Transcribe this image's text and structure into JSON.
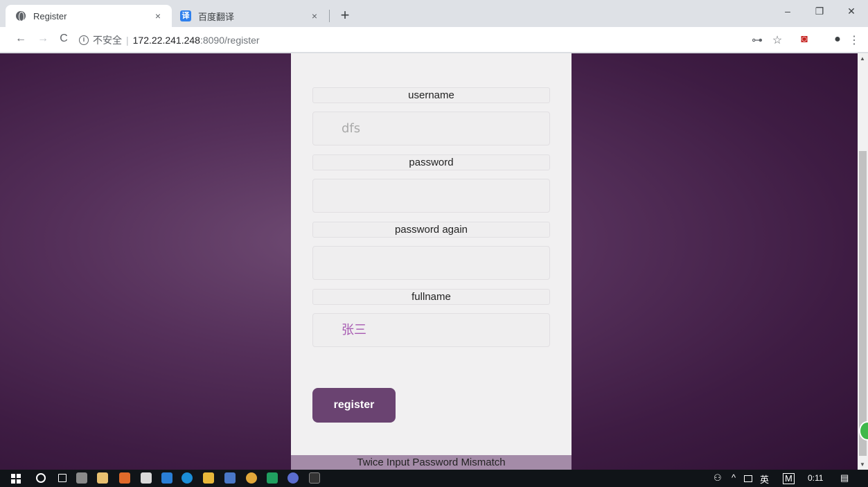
{
  "browser": {
    "tabs": [
      {
        "title": "Register",
        "favicon": "globe-icon",
        "active": true
      },
      {
        "title": "百度翻译",
        "favicon": "baidu-translate-icon",
        "favicon_text": "译",
        "active": false
      }
    ],
    "close_glyph": "×",
    "new_tab_glyph": "+",
    "window_controls": {
      "minimize": "–",
      "restore": "❐",
      "close": "✕"
    },
    "nav": {
      "back": "←",
      "forward": "→",
      "reload": "C"
    },
    "address": {
      "info_glyph": "i",
      "security_text": "不安全",
      "separator": "|",
      "host": "172.22.241.248",
      "path": ":8090/register"
    },
    "toolbar_icons": {
      "key": "⊶",
      "star": "☆",
      "extension": "◙",
      "account": "●",
      "menu": "⋮"
    }
  },
  "form": {
    "username_label": "username",
    "username_value": "dfs",
    "password_label": "password",
    "password_value": "",
    "password_again_label": "password again",
    "password_again_value": "",
    "fullname_label": "fullname",
    "fullname_value": "张三",
    "submit_label": "register",
    "error_message": "Twice Input Password Mismatch"
  },
  "taskbar": {
    "system": {
      "people": "⚇",
      "chevron": "^",
      "ime": "英",
      "ime2": "M",
      "time": "0:11",
      "notification": "▤"
    }
  },
  "colors": {
    "page_bg": "#4a2450",
    "panel_bg": "#f1f0f1",
    "button_bg": "#6a4371",
    "error_bar_bg": "#a48ba8",
    "fullname_text": "#a75ab2"
  }
}
